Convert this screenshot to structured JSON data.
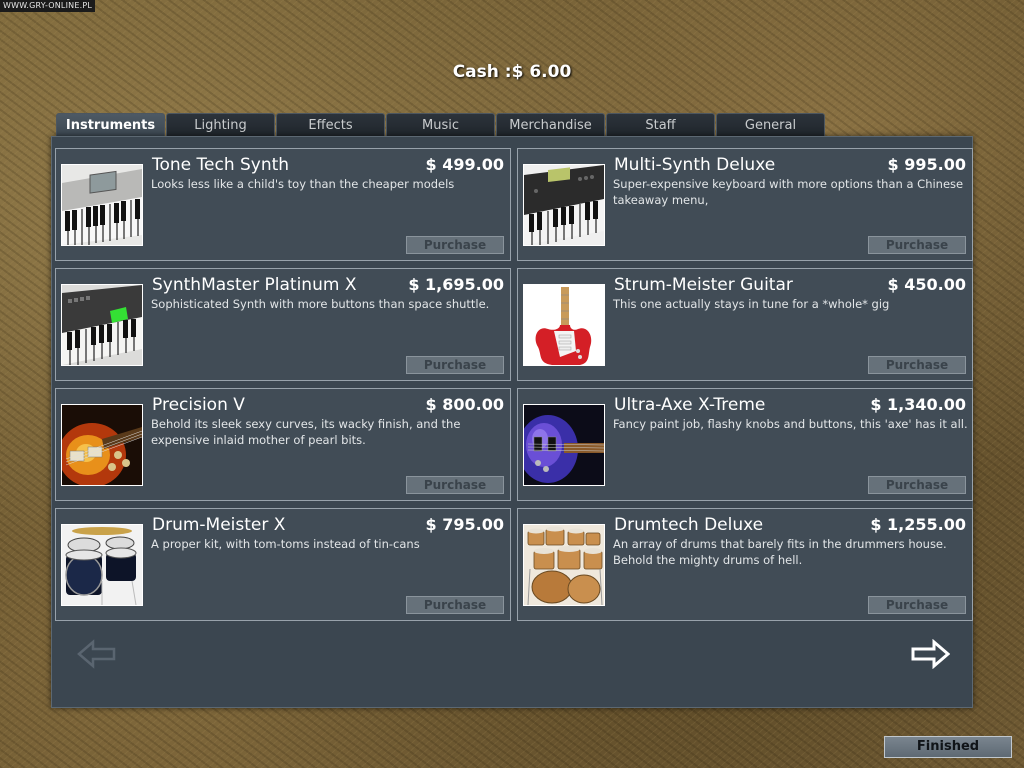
{
  "watermark": "WWW.GRY-ONLINE.PL",
  "cash": {
    "label": "Cash :",
    "value": "$ 6.00"
  },
  "tabs": [
    "Instruments",
    "Lighting",
    "Effects",
    "Music",
    "Merchandise",
    "Staff",
    "General"
  ],
  "active_tab": "Instruments",
  "items": [
    {
      "name": "Tone Tech Synth",
      "price": "$ 499.00",
      "description": "Looks less like a child's toy than the cheaper models",
      "button": "Purchase",
      "image_icon": "synth-keyboard-icon"
    },
    {
      "name": "Multi-Synth Deluxe",
      "price": "$ 995.00",
      "description": "Super-expensive keyboard with more options than a Chinese takeaway menu,",
      "button": "Purchase",
      "image_icon": "synth-keyboard-icon"
    },
    {
      "name": "SynthMaster Platinum X",
      "price": "$ 1,695.00",
      "description": "Sophisticated Synth with more buttons than space shuttle.",
      "button": "Purchase",
      "image_icon": "synth-keyboard-icon"
    },
    {
      "name": "Strum-Meister Guitar",
      "price": "$ 450.00",
      "description": "This one actually stays in tune for a *whole* gig",
      "button": "Purchase",
      "image_icon": "electric-guitar-icon"
    },
    {
      "name": "Precision V",
      "price": "$ 800.00",
      "description": "Behold its sleek sexy curves, its wacky finish, and the expensive inlaid mother of pearl bits.",
      "button": "Purchase",
      "image_icon": "electric-guitar-icon"
    },
    {
      "name": "Ultra-Axe X-Treme",
      "price": "$ 1,340.00",
      "description": "Fancy paint job, flashy knobs and buttons, this 'axe' has it all.",
      "button": "Purchase",
      "image_icon": "electric-guitar-icon"
    },
    {
      "name": "Drum-Meister X",
      "price": "$ 795.00",
      "description": "A proper kit, with tom-toms instead of tin-cans",
      "button": "Purchase",
      "image_icon": "drum-kit-icon"
    },
    {
      "name": "Drumtech Deluxe",
      "price": "$ 1,255.00",
      "description": "An array of drums that barely fits in the drummers house. Behold the mighty drums of hell.",
      "button": "Purchase",
      "image_icon": "drum-kit-icon"
    }
  ],
  "nav": {
    "prev_icon": "arrow-left-icon",
    "next_icon": "arrow-right-icon"
  },
  "finished_label": "Finished",
  "colors": {
    "panel": "#3b4650",
    "card": "#414c56",
    "card_border": "#98a2ab",
    "button": "#66717a"
  }
}
